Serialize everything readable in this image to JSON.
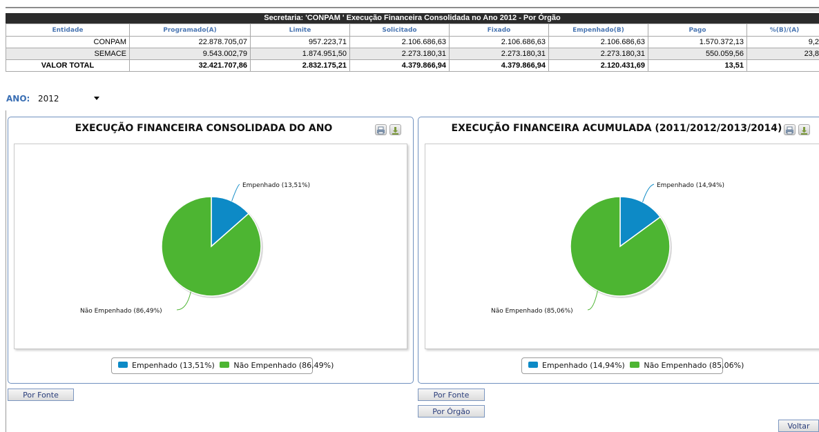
{
  "table": {
    "title": "Secretaria: 'CONPAM ' Execução Financeira Consolidada no Ano 2012 - Por Órgão",
    "headers": [
      "Entidade",
      "Programado(A)",
      "Limite",
      "Solicitado",
      "Fixado",
      "Empenhado(B)",
      "Pago",
      "%(B)/(A)"
    ],
    "rows": [
      [
        "CONPAM",
        "22.878.705,07",
        "957.223,71",
        "2.106.686,63",
        "2.106.686,63",
        "2.106.686,63",
        "1.570.372,13",
        "9,2"
      ],
      [
        "SEMACE",
        "9.543.002,79",
        "1.874.951,50",
        "2.273.180,31",
        "2.273.180,31",
        "2.273.180,31",
        "550.059,56",
        "23,8"
      ]
    ],
    "total": [
      "VALOR TOTAL",
      "32.421.707,86",
      "2.832.175,21",
      "4.379.866,94",
      "4.379.866,94",
      "2.120.431,69",
      "13,51",
      ""
    ]
  },
  "ano": {
    "label": "ANO:",
    "value": "2012"
  },
  "panels": [
    {
      "title": "EXECUÇÃO FINANCEIRA CONSOLIDADA DO ANO",
      "buttons": [
        "Por Fonte"
      ]
    },
    {
      "title": "EXECUÇÃO FINANCEIRA ACUMULADA (2011/2012/2013/2014)",
      "buttons": [
        "Por Fonte",
        "Por Órgão"
      ]
    }
  ],
  "chart_data": [
    {
      "type": "pie",
      "categories": [
        "Empenhado",
        "Não Empenhado"
      ],
      "values": [
        13.51,
        86.49
      ],
      "data_labels": [
        "Empenhado (13,51%)",
        "Não Empenhado (86,49%)"
      ],
      "legend": [
        "Empenhado (13,51%)",
        "Não Empenhado (86,49%)"
      ],
      "colors": [
        "#0d8ac6",
        "#4db532"
      ],
      "legend_placement": "bottom"
    },
    {
      "type": "pie",
      "categories": [
        "Empenhado",
        "Não Empenhado"
      ],
      "values": [
        14.94,
        85.06
      ],
      "data_labels": [
        "Empenhado (14,94%)",
        "Não Empenhado (85,06%)"
      ],
      "legend": [
        "Empenhado (14,94%)",
        "Não Empenhado (85,06%)"
      ],
      "colors": [
        "#0d8ac6",
        "#4db532"
      ],
      "legend_placement": "bottom"
    }
  ],
  "footer": {
    "voltar": "Voltar"
  },
  "icons": [
    "print-icon",
    "download-icon",
    "dropdown-caret-icon"
  ]
}
